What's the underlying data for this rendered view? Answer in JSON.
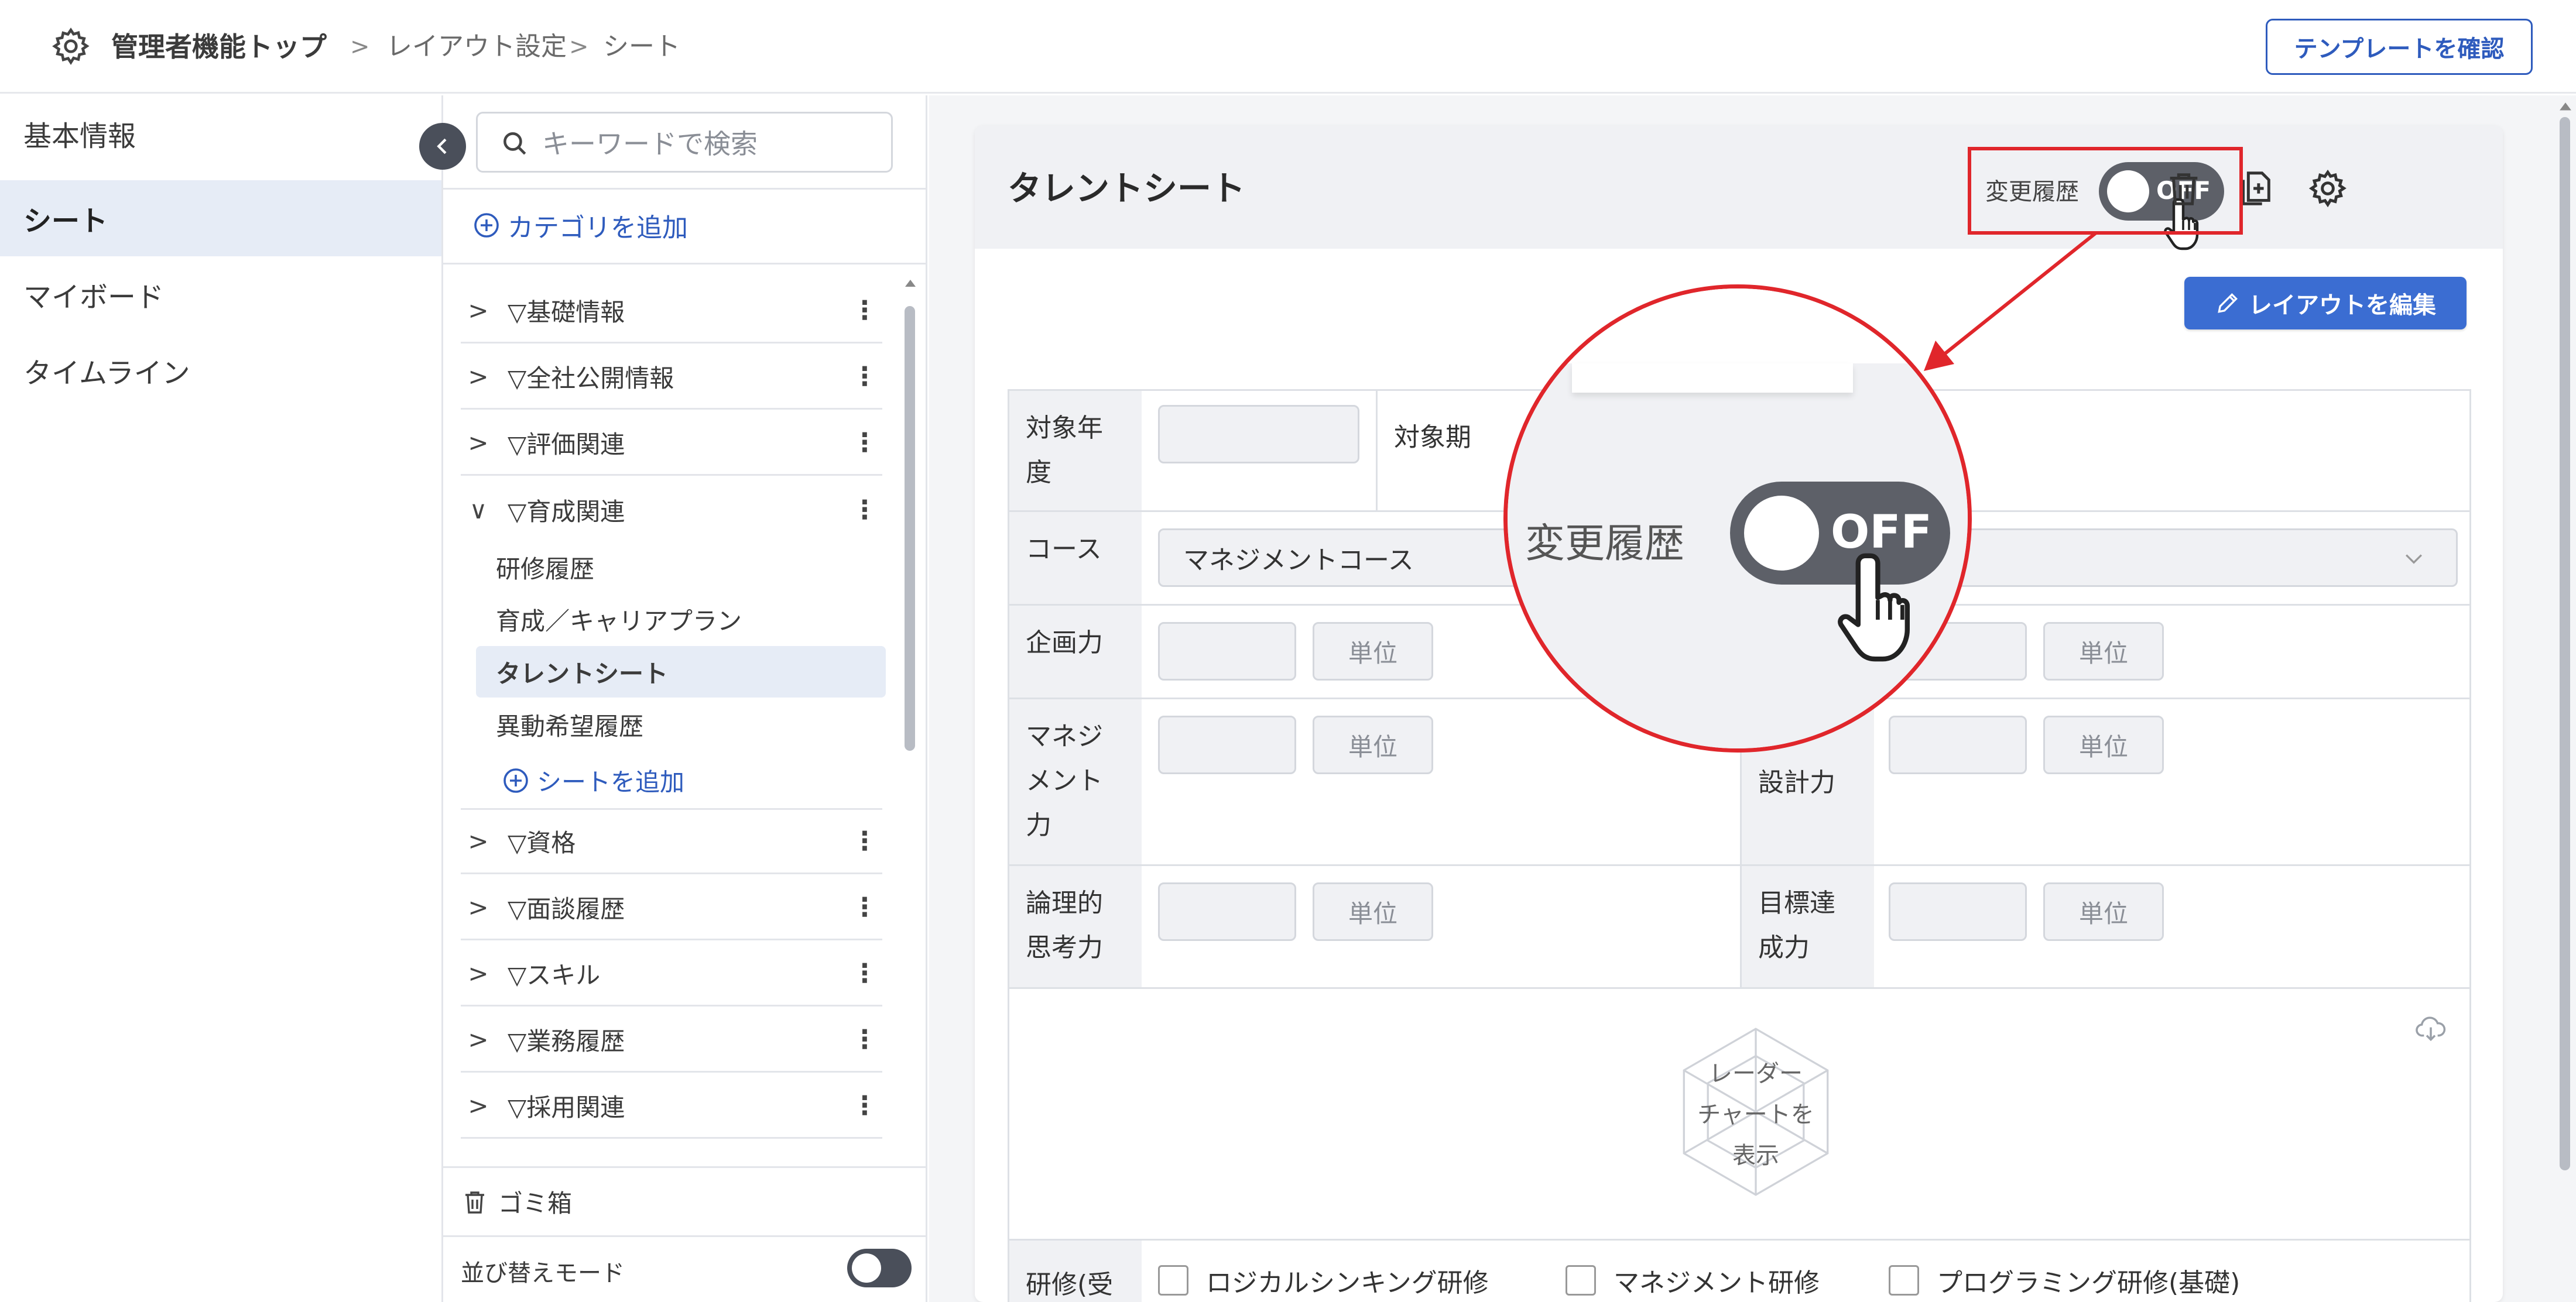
{
  "header": {
    "title": "管理者機能トップ",
    "breadcrumb": [
      "レイアウト設定",
      "シート"
    ],
    "separator": ">",
    "template_button": "テンプレートを確認"
  },
  "leftnav": {
    "items": [
      {
        "label": "基本情報",
        "active": false
      },
      {
        "label": "シート",
        "active": true
      },
      {
        "label": "マイボード",
        "active": false
      },
      {
        "label": "タイムライン",
        "active": false
      }
    ]
  },
  "tree": {
    "search_placeholder": "キーワードで検索",
    "add_category": "カテゴリを追加",
    "categories": [
      {
        "label": "▽基礎情報",
        "expanded": false
      },
      {
        "label": "▽全社公開情報",
        "expanded": false
      },
      {
        "label": "▽評価関連",
        "expanded": false
      },
      {
        "label": "▽育成関連",
        "expanded": true
      },
      {
        "label": "▽資格",
        "expanded": false
      },
      {
        "label": "▽面談履歴",
        "expanded": false
      },
      {
        "label": "▽スキル",
        "expanded": false
      },
      {
        "label": "▽業務履歴",
        "expanded": false
      },
      {
        "label": "▽採用関連",
        "expanded": false
      }
    ],
    "sheets": [
      {
        "label": "研修履歴",
        "active": false
      },
      {
        "label": "育成／キャリアプラン",
        "active": false
      },
      {
        "label": "タレントシート",
        "active": true
      },
      {
        "label": "異動希望履歴",
        "active": false
      }
    ],
    "add_sheet": "シートを追加",
    "trash": "ゴミ箱",
    "sort_mode": "並び替えモード",
    "sort_mode_on": false
  },
  "main": {
    "title": "タレントシート",
    "history_label": "変更履歴",
    "history_toggle": "OFF",
    "edit_layout_button": "レイアウトを編集",
    "form": {
      "target_year_label": "対象年度",
      "target_period_label": "対象期",
      "course_label": "コース",
      "course_value": "マネジメントコース",
      "planning_label": "企画力",
      "management_label": "マネジメント力",
      "design_label": "設計力",
      "logic_label": "論理的思考力",
      "goal_label": "目標達成力",
      "unit": "単位",
      "radar_text": [
        "レーダー",
        "チャートを",
        "表示"
      ],
      "training_label": "研修(受",
      "trainings": [
        "ロジカルシンキング研修",
        "マネジメント研修",
        "プログラミング研修(基礎)"
      ]
    }
  },
  "zoom": {
    "label": "変更履歴",
    "toggle": "OFF"
  },
  "colors": {
    "accent": "#2e5bbd",
    "button": "#3b6dd2",
    "highlight": "#e0262b",
    "toggle_off": "#5d6068"
  }
}
